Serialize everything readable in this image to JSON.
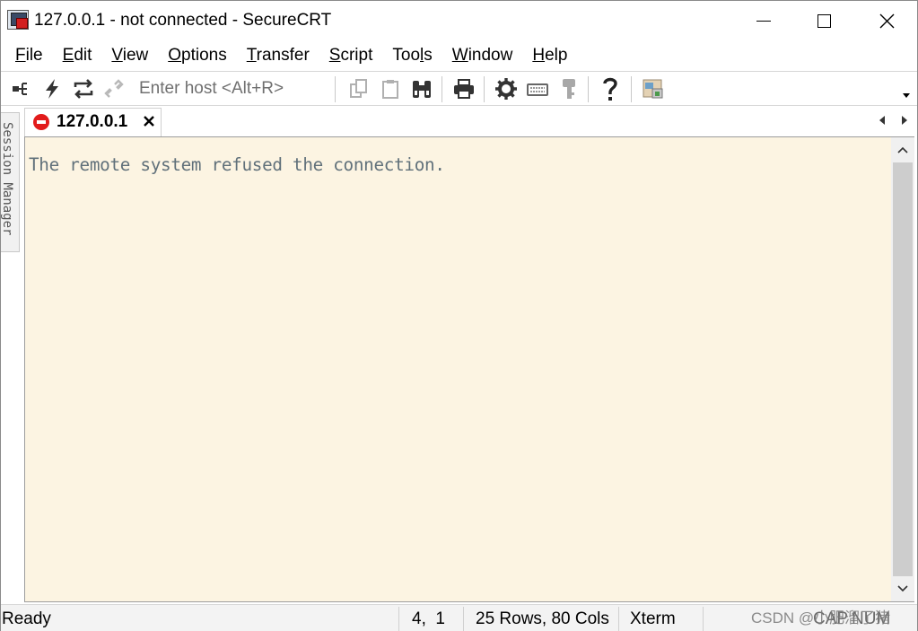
{
  "window": {
    "title": "127.0.0.1 - not connected - SecureCRT"
  },
  "menu": {
    "items": [
      {
        "key": "F",
        "rest": "ile"
      },
      {
        "key": "E",
        "rest": "dit"
      },
      {
        "key": "V",
        "rest": "iew"
      },
      {
        "key": "O",
        "rest": "ptions"
      },
      {
        "key": "T",
        "rest": "ransfer"
      },
      {
        "key": "S",
        "rest": "cript"
      },
      {
        "pre": "Too",
        "key": "l",
        "rest": "s"
      },
      {
        "key": "W",
        "rest": "indow"
      },
      {
        "key": "H",
        "rest": "elp"
      }
    ]
  },
  "toolbar": {
    "host_placeholder": "Enter host <Alt+R>",
    "icons": [
      "connect-bar-icon",
      "quick-connect-icon",
      "reconnect-icon",
      "disconnect-icon",
      "copy-icon",
      "paste-icon",
      "find-icon",
      "print-icon",
      "session-options-icon",
      "keymap-icon",
      "public-key-icon",
      "help-icon",
      "sftp-icon"
    ]
  },
  "side_panel": {
    "label": "Session Manager"
  },
  "session_tab": {
    "label": "127.0.0.1",
    "status_color": "#e21b1b"
  },
  "terminal": {
    "lines": [
      "The remote system refused the connection."
    ],
    "background": "#fcf4e2",
    "foreground": "#60707a"
  },
  "statusbar": {
    "ready": "Ready",
    "position": "4,  1",
    "size": "25 Rows, 80 Cols",
    "emulation": "Xterm",
    "caps": "CAP",
    "num": "NUM"
  },
  "watermark": "CSDN @小肥溜了猪"
}
